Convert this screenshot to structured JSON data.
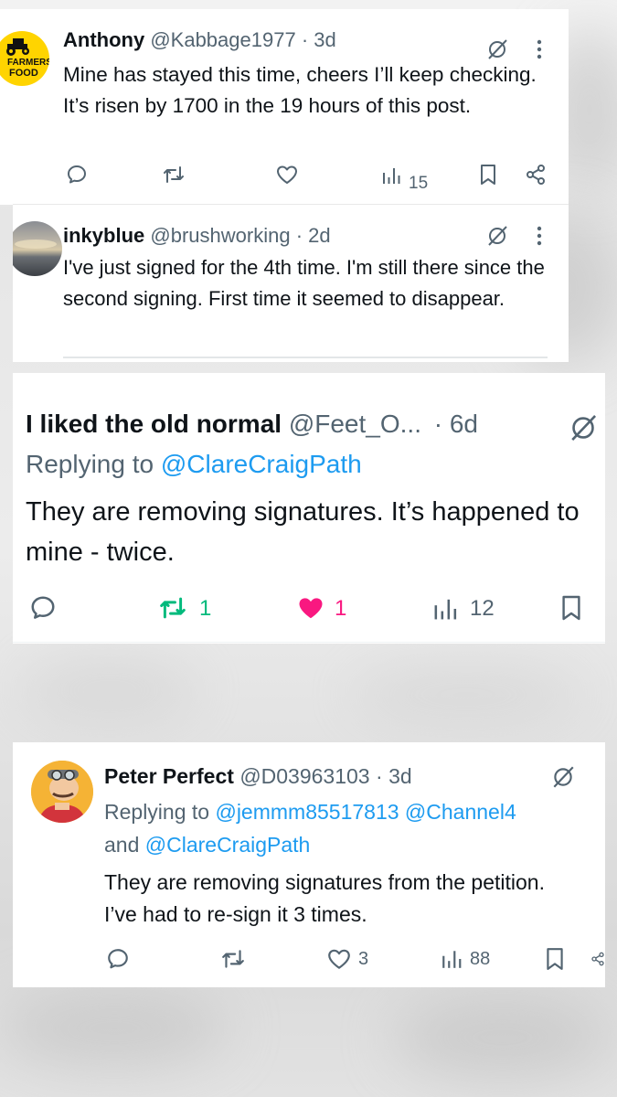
{
  "tweets": [
    {
      "name": "Anthony",
      "handle": "@Kabbage1977",
      "dot": "·",
      "time": "3d",
      "avatar_text": [
        "FARMERS",
        "FOOD"
      ],
      "text": "Mine has stayed this time, cheers I’ll keep checking. It’s risen by 1700 in the 19 hours of this post.",
      "views": "15"
    },
    {
      "name": "inkyblue",
      "handle": "@brushworking",
      "dot": "·",
      "time": "2d",
      "text": "I've just signed for the 4th time.  I'm still there since the second signing.  First time it seemed to disappear."
    },
    {
      "name": "I liked the old normal",
      "handle": "@Feet_O...",
      "dot": "·",
      "time": "6d",
      "replying_prefix": "Replying to",
      "replying_to": "@ClareCraigPath",
      "text": "They are removing signatures. It’s happened to mine - twice.",
      "retweets": "1",
      "likes": "1",
      "views": "12"
    },
    {
      "name": "Peter Perfect",
      "handle": "@D03963103",
      "dot": "·",
      "time": "3d",
      "replying_prefix": "Replying to",
      "replying_to_1": "@jemmm85517813",
      "replying_to_2": "@Channel4",
      "replying_and": "and",
      "replying_to_3": "@ClareCraigPath",
      "text": "They are removing signatures from the petition. I’ve had to re-sign it 3 times.",
      "likes": "3",
      "views": "88"
    }
  ],
  "colors": {
    "text": "#0f1419",
    "muted": "#536471",
    "link": "#1d9bf0",
    "retweet_active": "#00ba7c",
    "like_active": "#f91880",
    "avatar_farmers": "#ffd400"
  },
  "icons": [
    "reply-icon",
    "retweet-icon",
    "like-icon",
    "views-icon",
    "bookmark-icon",
    "share-icon",
    "grok-slash-icon",
    "more-icon"
  ]
}
